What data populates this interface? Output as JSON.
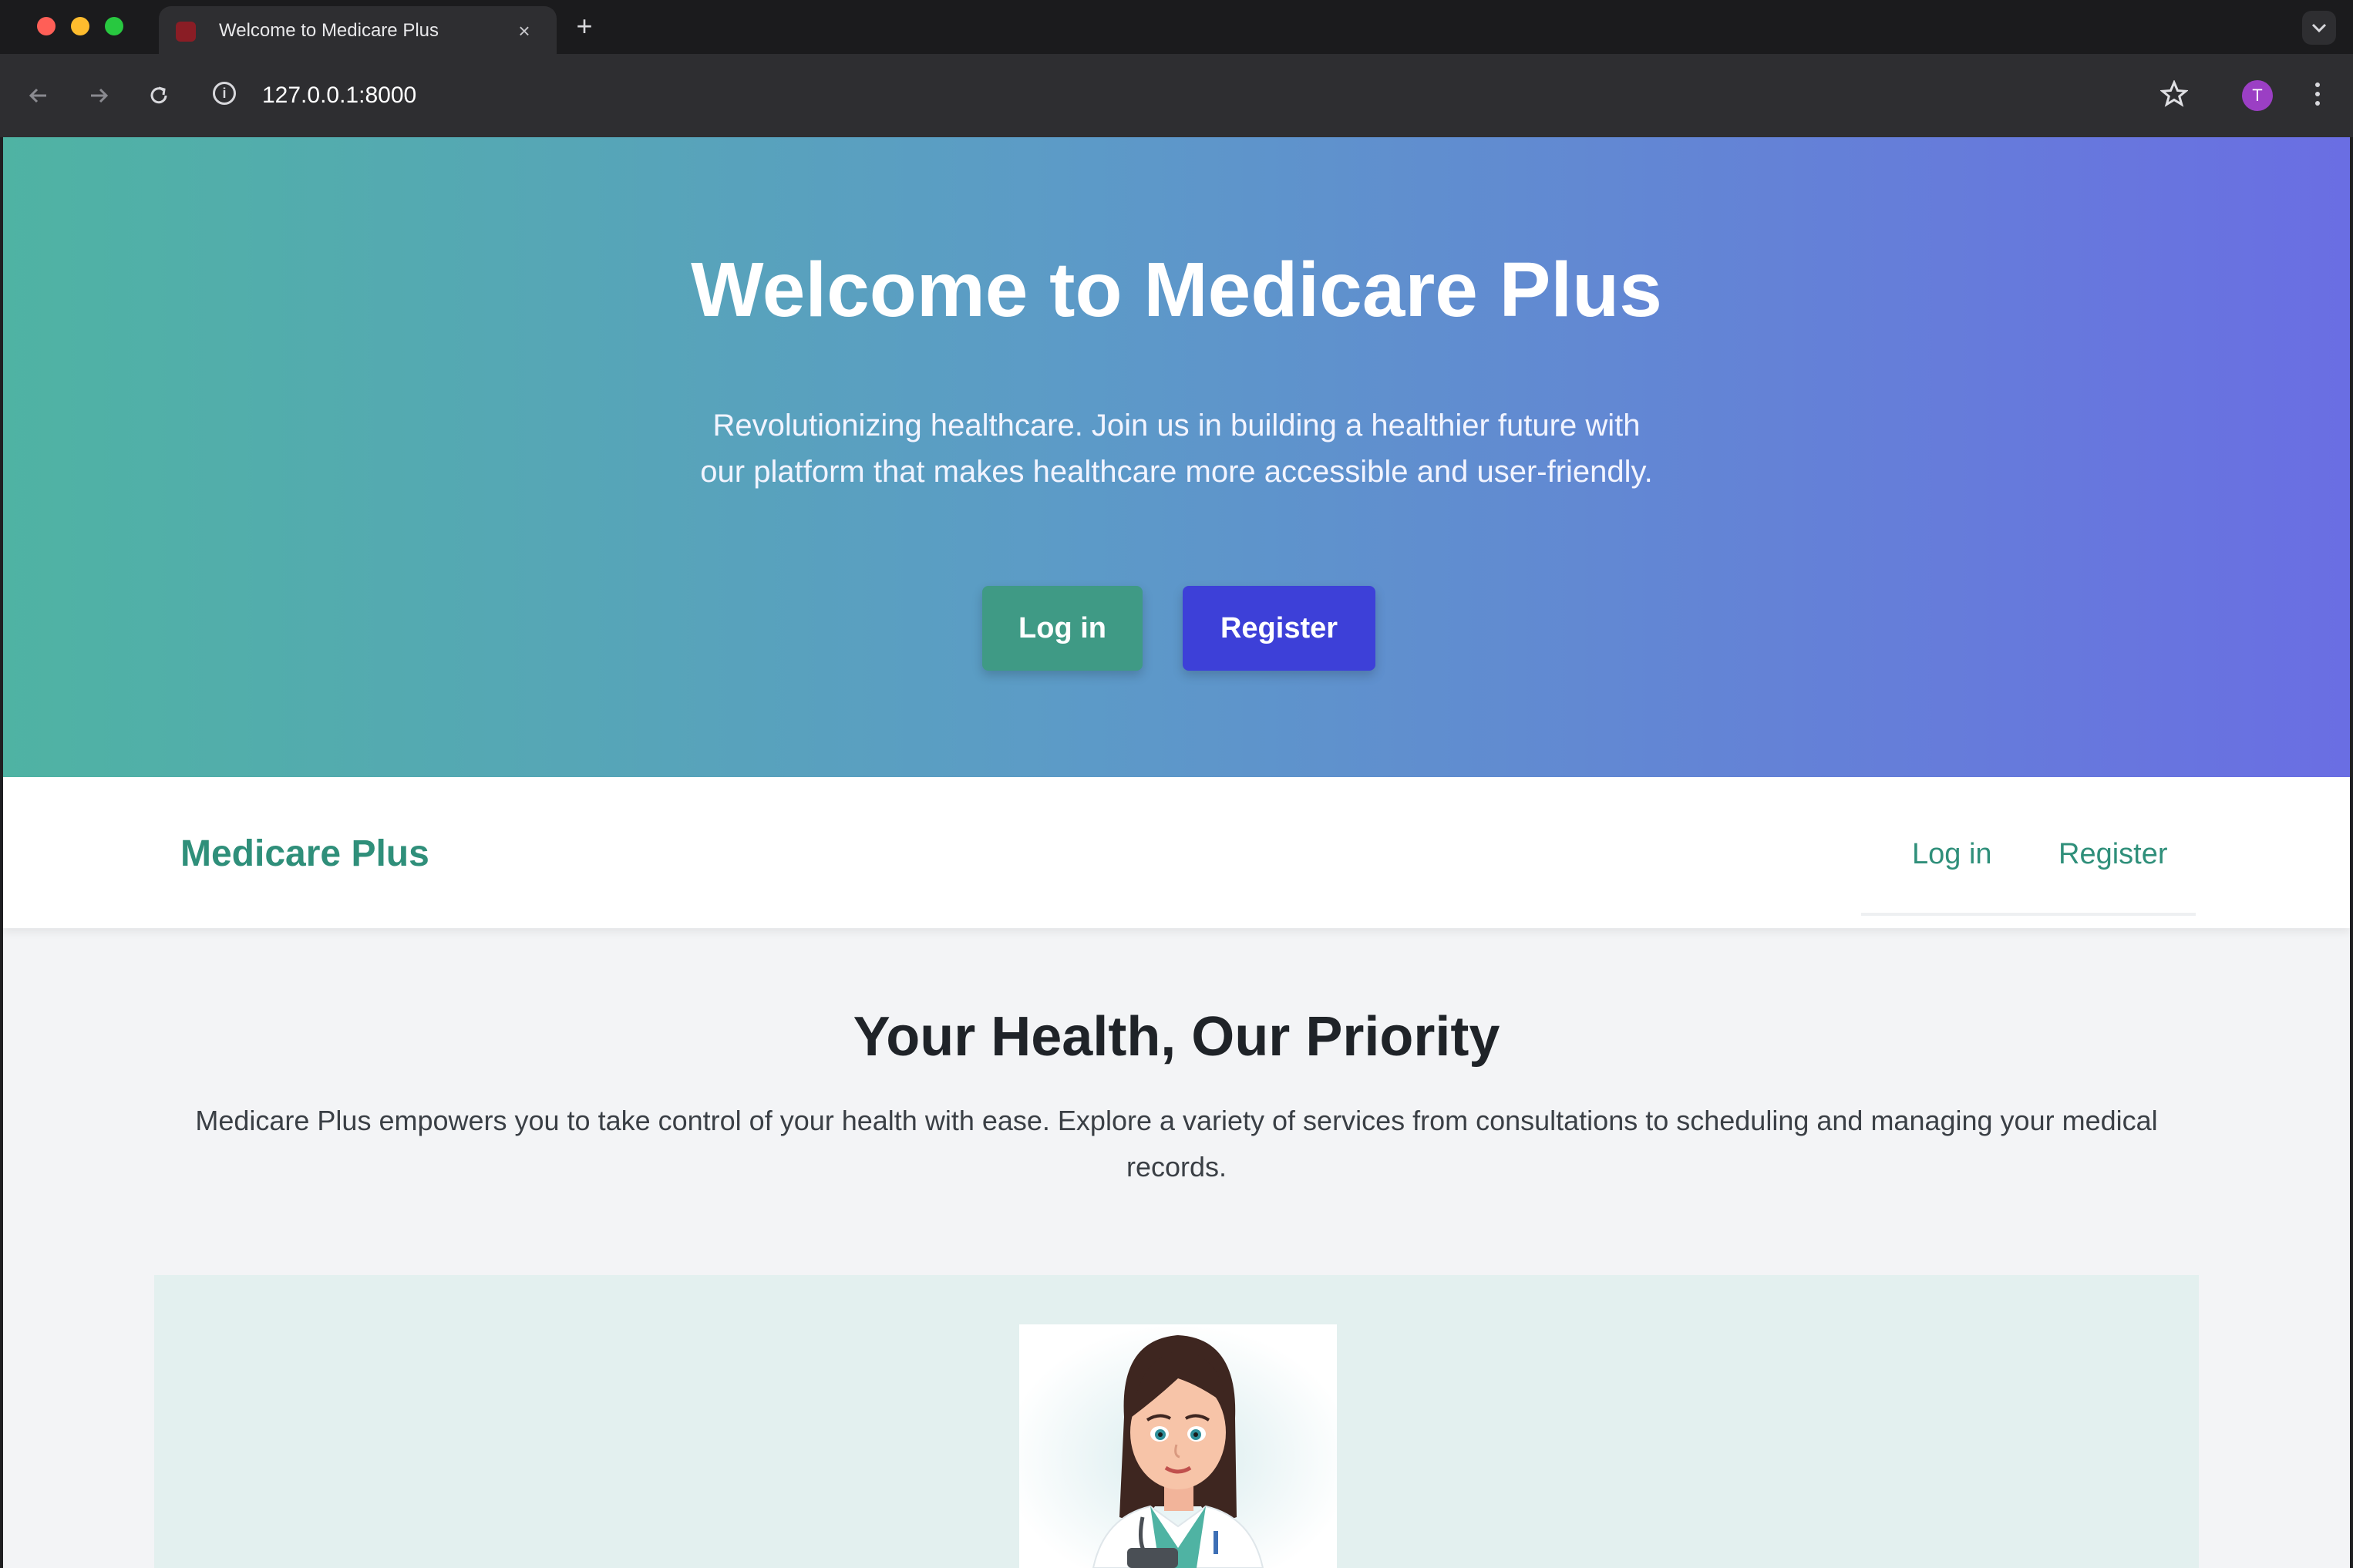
{
  "browser": {
    "tab_title": "Welcome to Medicare Plus",
    "tab_close": "×",
    "new_tab": "+",
    "url": "127.0.0.1:8000",
    "profile_initial": "T",
    "icons": {
      "back": "back-arrow-icon",
      "forward": "forward-arrow-icon",
      "reload": "reload-icon",
      "info": "info-icon",
      "star": "star-icon",
      "menu": "kebab-menu-icon",
      "tab_list": "chevron-down-icon"
    }
  },
  "hero": {
    "title": "Welcome to Medicare Plus",
    "subtitle": "Revolutionizing healthcare. Join us in building a healthier future with our platform that makes healthcare more accessible and user-friendly.",
    "login_label": "Log in",
    "register_label": "Register"
  },
  "navbar": {
    "brand": "Medicare Plus",
    "login_label": "Log in",
    "register_label": "Register"
  },
  "section": {
    "title": "Your Health, Our Priority",
    "text": "Medicare Plus empowers you to take control of your health with ease. Explore a variety of services from consultations to scheduling and managing your medical records."
  },
  "colors": {
    "brand_teal": "#2f8f7a",
    "hero_gradient_start": "#4fb3a3",
    "hero_gradient_end": "#6a6ee3",
    "register_button": "#3d40d8",
    "login_button": "#3f9a85"
  }
}
